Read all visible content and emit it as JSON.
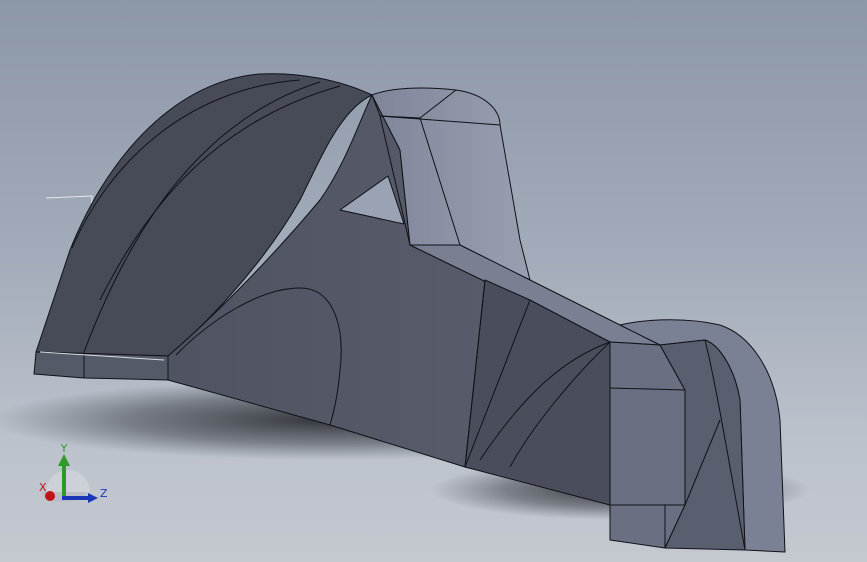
{
  "viewport": {
    "background_top": "#8c97a8",
    "background_bottom": "#c4c8cf"
  },
  "model": {
    "face_dark": "#474b58",
    "face_mid": "#555a68",
    "face_light": "#6e7385",
    "face_lighter": "#8a8fa0",
    "edge_color": "#101218"
  },
  "triad": {
    "x_label": "X",
    "y_label": "Y",
    "z_label": "Z",
    "x_color": "#c0141a",
    "y_color": "#2e9a2a",
    "z_color": "#1a36b8"
  }
}
